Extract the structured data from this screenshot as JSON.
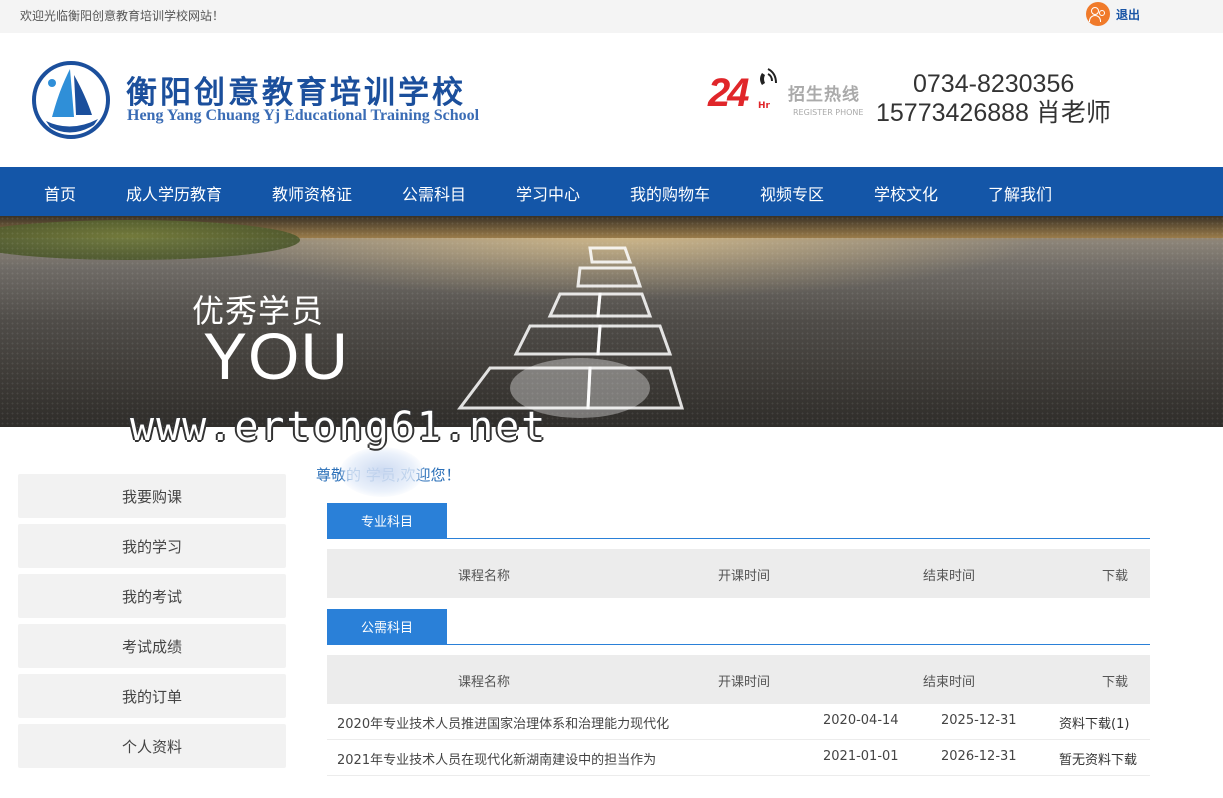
{
  "topbar": {
    "welcome": "欢迎光临衡阳创意教育培训学校网站！",
    "logout": "退出"
  },
  "header": {
    "school_name_cn": "衡阳创意教育培训学校",
    "school_name_en": "Heng Yang Chuang Yj  Educational Training School",
    "hotline_badge_number": "24",
    "hotline_badge_unit": "Hr",
    "hotline_title": "招生热线",
    "hotline_subtitle": "REGISTER PHONE",
    "phone_1": "0734-8230356",
    "phone_2": "15773426888 肖老师"
  },
  "nav": {
    "items": [
      {
        "label": "首页"
      },
      {
        "label": "成人学历教育"
      },
      {
        "label": "教师资格证"
      },
      {
        "label": "公需科目"
      },
      {
        "label": "学习中心"
      },
      {
        "label": "我的购物车"
      },
      {
        "label": "视频专区"
      },
      {
        "label": "学校文化"
      },
      {
        "label": "了解我们"
      }
    ]
  },
  "banner": {
    "tagline_cn": "优秀学员",
    "tagline_en": "YOU",
    "watermark": "www.ertong61.net"
  },
  "sidebar": {
    "items": [
      {
        "label": "我要购课"
      },
      {
        "label": "我的学习"
      },
      {
        "label": "我的考试"
      },
      {
        "label": "考试成绩"
      },
      {
        "label": "我的订单"
      },
      {
        "label": "个人资料"
      }
    ]
  },
  "main": {
    "greeting": "尊敬的          学员,欢迎您！",
    "sections": [
      {
        "title": "专业科目",
        "columns": [
          "课程名称",
          "开课时间",
          "结束时间",
          "下载"
        ],
        "rows": []
      },
      {
        "title": "公需科目",
        "columns": [
          "课程名称",
          "开课时间",
          "结束时间",
          "下载"
        ],
        "rows": [
          {
            "name": "2020年专业技术人员推进国家治理体系和治理能力现代化",
            "start": "2020-04-14",
            "end": "2025-12-31",
            "download": "资料下载(1)"
          },
          {
            "name": "2021年专业技术人员在现代化新湖南建设中的担当作为",
            "start": "2021-01-01",
            "end": "2026-12-31",
            "download": "暂无资料下载"
          }
        ]
      }
    ]
  },
  "colors": {
    "nav_bg": "#1456a8",
    "accent_blue": "#2a80d8",
    "hotline_red": "#e0262a",
    "logout_orange": "#f07a2a"
  }
}
